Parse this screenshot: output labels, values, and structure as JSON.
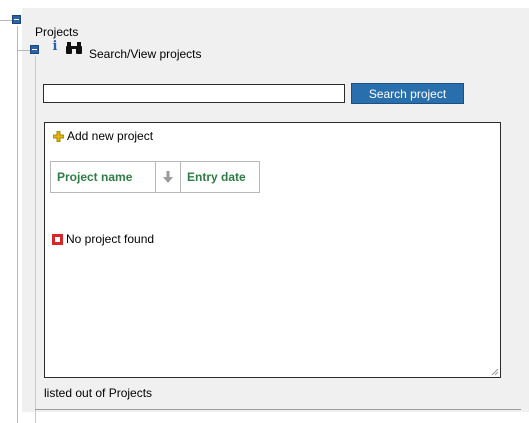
{
  "tree": {
    "root_label": "Projects",
    "node_label": "Search/View projects"
  },
  "search": {
    "value": "",
    "button_label": "Search project"
  },
  "results": {
    "add_label": "Add new project",
    "columns": {
      "name": "Project name",
      "date": "Entry date"
    },
    "empty_message": "No project found"
  },
  "footer": {
    "text": "listed out of Projects"
  },
  "colors": {
    "accent": "#2a6fad",
    "header_text": "#2e7d46",
    "error": "#d62828",
    "add_icon": "#e6b800"
  },
  "icons": {
    "tree_toggle": "minus-square-icon",
    "info": "info-icon",
    "search": "binoculars-icon",
    "add": "plus-icon",
    "sort": "sort-arrow-icon",
    "empty": "error-icon"
  }
}
